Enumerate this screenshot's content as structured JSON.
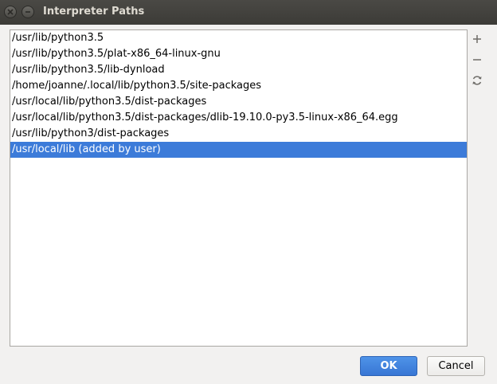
{
  "window": {
    "title": "Interpreter Paths"
  },
  "paths": [
    "/usr/lib/python3.5",
    "/usr/lib/python3.5/plat-x86_64-linux-gnu",
    "/usr/lib/python3.5/lib-dynload",
    "/home/joanne/.local/lib/python3.5/site-packages",
    "/usr/local/lib/python3.5/dist-packages",
    "/usr/local/lib/python3.5/dist-packages/dlib-19.10.0-py3.5-linux-x86_64.egg",
    "/usr/lib/python3/dist-packages",
    "/usr/local/lib  (added by user)"
  ],
  "selected_index": 7,
  "toolbar": {
    "add_icon": "plus-icon",
    "remove_icon": "minus-icon",
    "reload_icon": "refresh-icon"
  },
  "buttons": {
    "ok_label": "OK",
    "cancel_label": "Cancel"
  },
  "colors": {
    "selection": "#3c7bd9",
    "ok_button": "#3876d4",
    "titlebar": "#3c3b37"
  }
}
